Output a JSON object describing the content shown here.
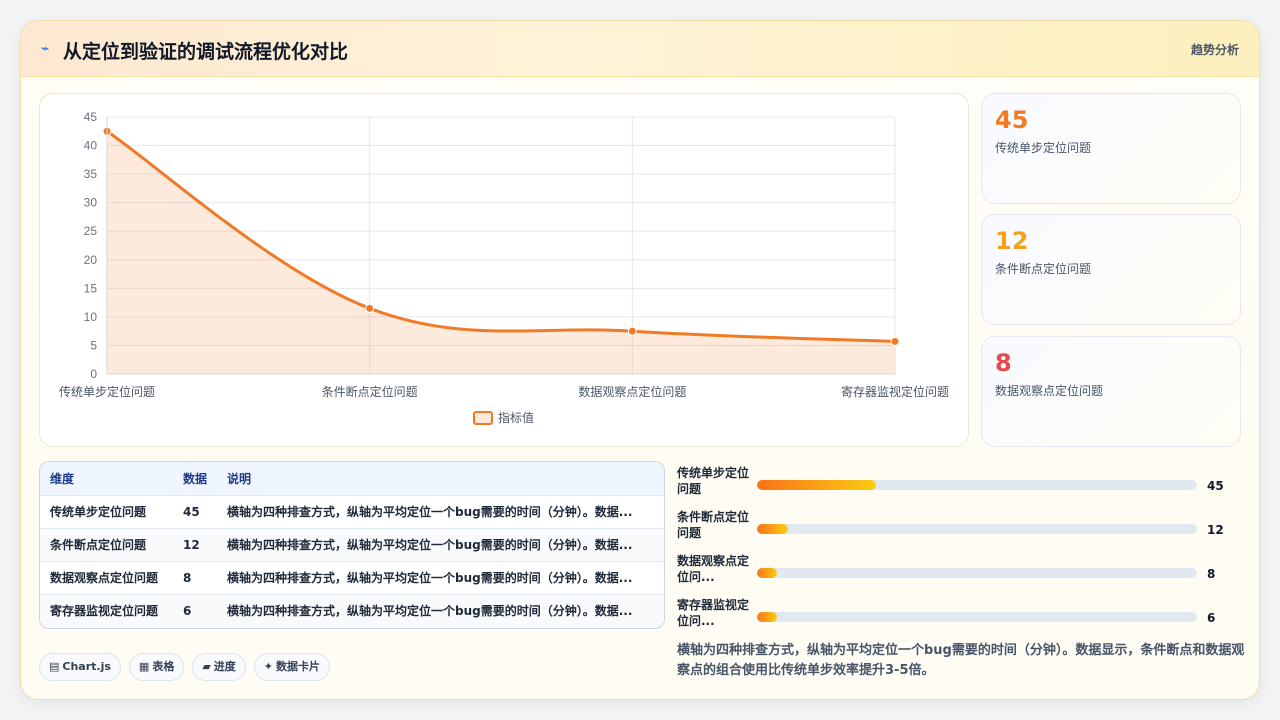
{
  "header": {
    "title": "从定位到验证的调试流程优化对比",
    "icon": "lightning-icon",
    "link": "趋势分析"
  },
  "chart_data": {
    "type": "area",
    "categories": [
      "传统单步定位问题",
      "条件断点定位问题",
      "数据观察点定位问题",
      "寄存器监视定位问题"
    ],
    "series": [
      {
        "name": "指标值",
        "values": [
          42.5,
          11.5,
          7.5,
          5.7
        ],
        "color": "#f07a25"
      }
    ],
    "ylim": [
      0,
      45
    ],
    "yticks": [
      0,
      5,
      10,
      15,
      20,
      25,
      30,
      35,
      40,
      45
    ],
    "legend": "bottom",
    "grid": true
  },
  "stats": [
    {
      "value": "45",
      "label": "传统单步定位问题",
      "color": "#f07a25"
    },
    {
      "value": "12",
      "label": "条件断点定位问题",
      "color": "#f5a11c"
    },
    {
      "value": "8",
      "label": "数据观察点定位问题",
      "color": "#e5484d"
    }
  ],
  "table": {
    "headers": [
      "维度",
      "数据",
      "说明"
    ],
    "rows": [
      [
        "传统单步定位问题",
        "45",
        "横轴为四种排查方式，纵轴为平均定位一个bug需要的时间（分钟）。数据..."
      ],
      [
        "条件断点定位问题",
        "12",
        "横轴为四种排查方式，纵轴为平均定位一个bug需要的时间（分钟）。数据..."
      ],
      [
        "数据观察点定位问题",
        "8",
        "横轴为四种排查方式，纵轴为平均定位一个bug需要的时间（分钟）。数据..."
      ],
      [
        "寄存器监视定位问题",
        "6",
        "横轴为四种排查方式，纵轴为平均定位一个bug需要的时间（分钟）。数据..."
      ]
    ]
  },
  "progress": {
    "max": 45,
    "items": [
      {
        "label": "传统单步定位问题",
        "value": 45,
        "shown": "45",
        "fill_fraction": 0.27
      },
      {
        "label": "条件断点定位问题",
        "value": 12,
        "shown": "12",
        "fill_fraction": 0.07
      },
      {
        "label": "数据观察点定位问...",
        "value": 8,
        "shown": "8",
        "fill_fraction": 0.045
      },
      {
        "label": "寄存器监视定位问...",
        "value": 6,
        "shown": "6",
        "fill_fraction": 0.045
      }
    ]
  },
  "summary": "横轴为四种排查方式，纵轴为平均定位一个bug需要的时间（分钟）。数据显示，条件断点和数据观察点的组合使用比传统单步效率提升3-5倍。",
  "chips": [
    {
      "icon": "chart-icon",
      "glyph": "▤",
      "label": "Chart.js"
    },
    {
      "icon": "table-icon",
      "glyph": "▦",
      "label": "表格"
    },
    {
      "icon": "progress-icon",
      "glyph": "▰",
      "label": "进度"
    },
    {
      "icon": "card-icon",
      "glyph": "✦",
      "label": "数据卡片"
    }
  ]
}
